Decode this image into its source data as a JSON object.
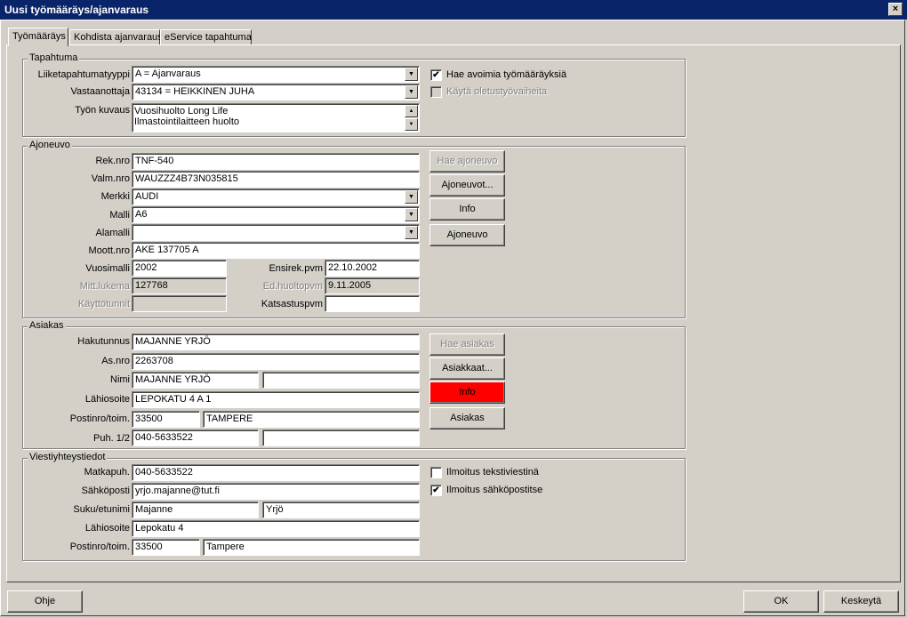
{
  "window": {
    "title": "Uusi työmääräys/ajanvaraus",
    "close": "×"
  },
  "tabs": [
    "Työmääräys",
    "Kohdista ajanvaraus",
    "eService tapahtuma"
  ],
  "tapahtuma": {
    "legend": "Tapahtuma",
    "liiketapahtumatyyppi_label": "Liiketapahtumatyyppi",
    "liiketapahtumatyyppi_value": "A = Ajanvaraus",
    "vastaanottaja_label": "Vastaanottaja",
    "vastaanottaja_value": "43134 = HEIKKINEN JUHA",
    "tyon_kuvaus_label": "Työn kuvaus",
    "tyon_kuvaus_lines": [
      "Vuosihuolto Long Life",
      "Ilmastointilaitteen huolto"
    ],
    "hae_avoimia_label": "Hae avoimia työmääräyksiä",
    "hae_avoimia_checked": "✔",
    "kayta_oletus_label": "Käytä oletustyövaiheita"
  },
  "ajoneuvo": {
    "legend": "Ajoneuvo",
    "rek_label": "Rek.nro",
    "rek_value": "TNF-540",
    "valm_label": "Valm.nro",
    "valm_value": "WAUZZZ4B73N035815",
    "merkki_label": "Merkki",
    "merkki_value": "AUDI",
    "malli_label": "Malli",
    "malli_value": "A6",
    "alamalli_label": "Alamalli",
    "alamalli_value": "",
    "moott_label": "Moott.nro",
    "moott_value": "AKE 137705  A",
    "vuosimalli_label": "Vuosimalli",
    "vuosimalli_value": "2002",
    "mitt_label": "Mitt.lukema",
    "mitt_value": "127768",
    "kayttotunnit_label": "Käyttötunnit",
    "kayttotunnit_value": "",
    "ensirek_label": "Ensirek.pvm",
    "ensirek_value": "22.10.2002",
    "edhuolto_label": "Ed.huoltopvm",
    "edhuolto_value": "9.11.2005",
    "katsastus_label": "Katsastuspvm",
    "katsastus_value": "",
    "btn_hae": "Hae ajoneuvo",
    "btn_ajoneuvot": "Ajoneuvot...",
    "btn_info": "Info",
    "btn_ajoneuvo": "Ajoneuvo"
  },
  "asiakas": {
    "legend": "Asiakas",
    "hakutunnus_label": "Hakutunnus",
    "hakutunnus_value": "MAJANNE YRJÖ",
    "asnro_label": "As.nro",
    "asnro_value": "2263708",
    "nimi_label": "Nimi",
    "nimi_value": "MAJANNE YRJÖ",
    "nimi2_value": "",
    "lahiosoite_label": "Lähiosoite",
    "lahiosoite_value": "LEPOKATU 4 A 1",
    "postinro_label": "Postinro/toim.",
    "postinro_value": "33500",
    "toim_value": "TAMPERE",
    "puh_label": "Puh. 1/2",
    "puh1_value": "040-5633522",
    "puh2_value": "",
    "btn_hae": "Hae asiakas",
    "btn_asiakkaat": "Asiakkaat...",
    "btn_info": "Info",
    "btn_asiakas": "Asiakas",
    "info_color": "#ff0000"
  },
  "viesti": {
    "legend": "Viestiyhteystiedot",
    "matkapuh_label": "Matkapuh.",
    "matkapuh_value": "040-5633522",
    "sahkoposti_label": "Sähköposti",
    "sahkoposti_value": "yrjo.majanne@tut.fi",
    "suku_label": "Suku/etunimi",
    "suku_value": "Majanne",
    "etunimi_value": "Yrjö",
    "lahiosoite_label": "Lähiosoite",
    "lahiosoite_value": "Lepokatu 4",
    "postinro_label": "Postinro/toim.",
    "postinro_value": "33500",
    "toim_value": "Tampere",
    "tekstiviesti_label": "Ilmoitus tekstiviestinä",
    "sahkoposti_cb_label": "Ilmoitus sähköpostitse",
    "sahkoposti_cb_checked": "✔"
  },
  "footer": {
    "ohje": "Ohje",
    "ok": "OK",
    "keskeyta": "Keskeytä"
  },
  "icons": {
    "combo_arrow": "▼",
    "scroll_up": "▲",
    "scroll_down": "▼"
  }
}
